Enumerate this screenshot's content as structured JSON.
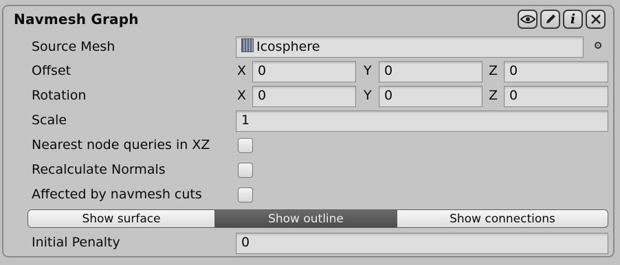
{
  "panel": {
    "title": "Navmesh Graph",
    "header_buttons": [
      {
        "icon": "eye-icon"
      },
      {
        "icon": "pencil-icon"
      },
      {
        "icon": "info-icon",
        "glyph": "i"
      },
      {
        "icon": "close-icon"
      }
    ]
  },
  "source_mesh": {
    "label": "Source Mesh",
    "value": "Icosphere",
    "icon": "mesh-icon"
  },
  "offset": {
    "label": "Offset",
    "x_label": "X",
    "x": "0",
    "y_label": "Y",
    "y": "0",
    "z_label": "Z",
    "z": "0"
  },
  "rotation": {
    "label": "Rotation",
    "x_label": "X",
    "x": "0",
    "y_label": "Y",
    "y": "0",
    "z_label": "Z",
    "z": "0"
  },
  "scale": {
    "label": "Scale",
    "value": "1"
  },
  "options": [
    {
      "label": "Nearest node queries in XZ",
      "checked": false
    },
    {
      "label": "Recalculate Normals",
      "checked": false
    },
    {
      "label": "Affected by navmesh cuts",
      "checked": false
    }
  ],
  "display_mode": {
    "items": [
      {
        "label": "Show surface",
        "active": false
      },
      {
        "label": "Show outline",
        "active": true
      },
      {
        "label": "Show connections",
        "active": false
      }
    ]
  },
  "initial_penalty": {
    "label": "Initial Penalty",
    "value": "0"
  }
}
